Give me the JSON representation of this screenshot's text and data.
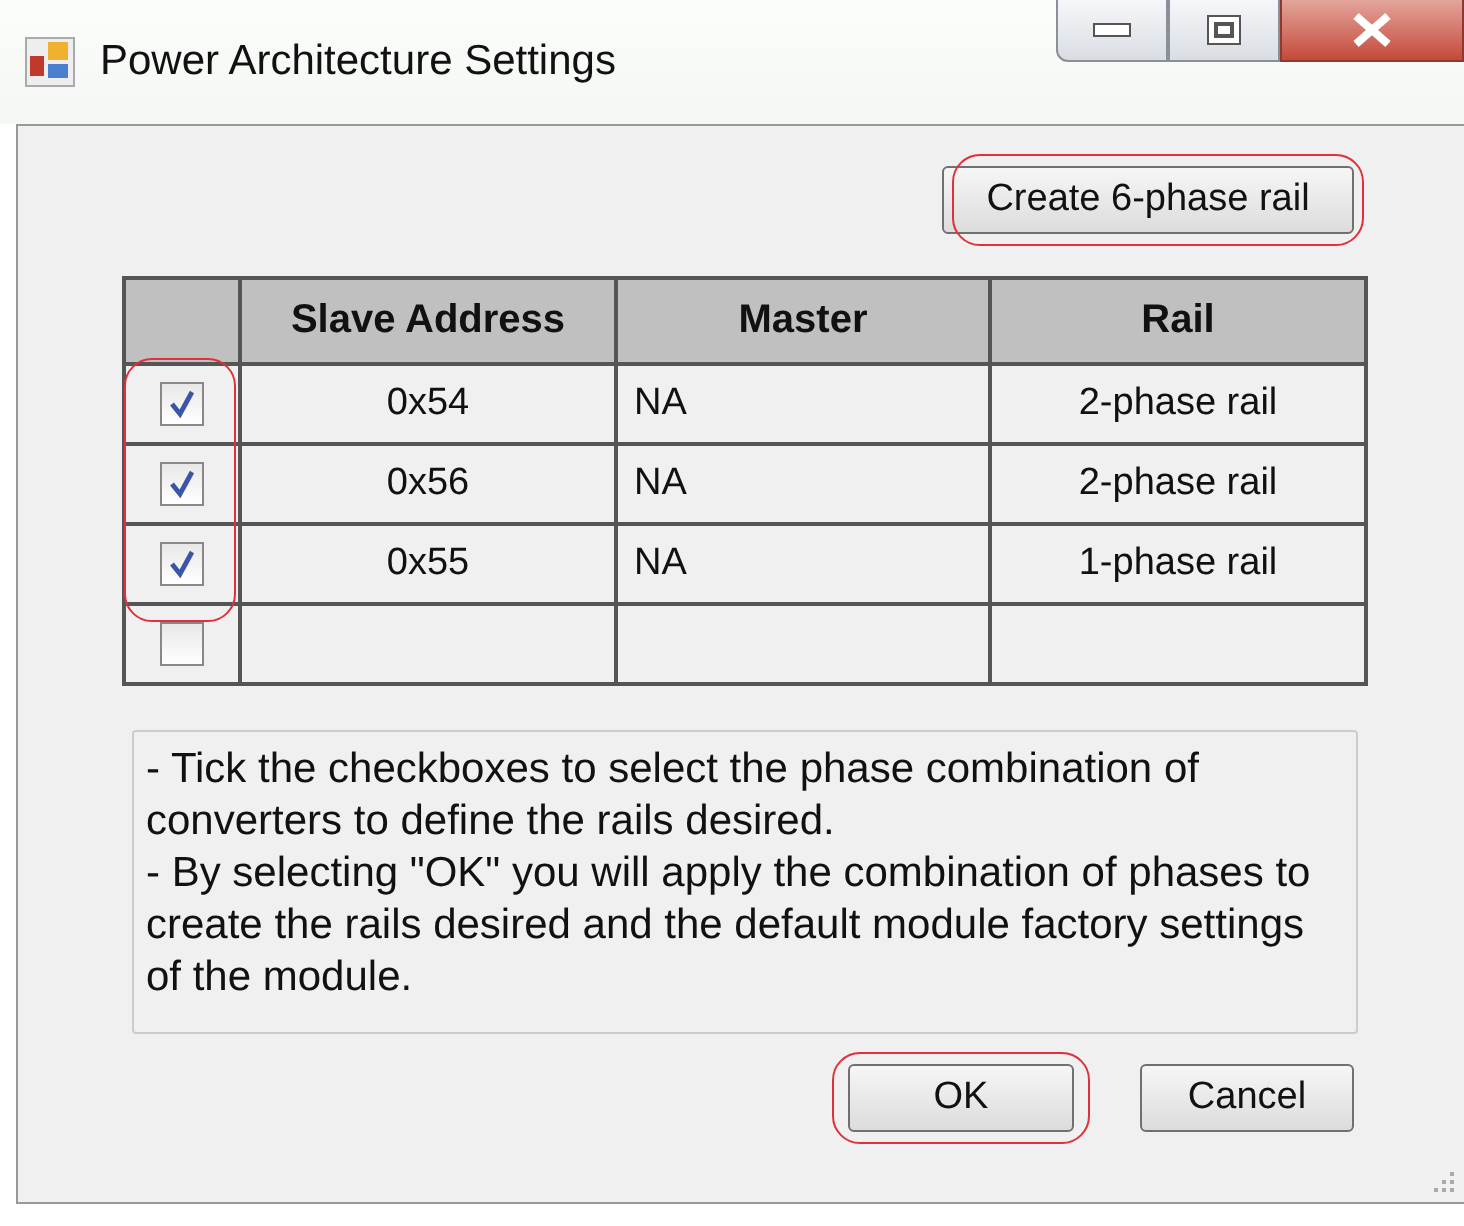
{
  "window": {
    "title": "Power Architecture Settings"
  },
  "create_button": {
    "label": "Create 6-phase rail",
    "highlighted": true
  },
  "table": {
    "columns": [
      "Slave Address",
      "Master",
      "Rail"
    ],
    "rows": [
      {
        "checked": true,
        "highlighted": true,
        "cells": [
          "0x54",
          "NA",
          "2-phase rail"
        ]
      },
      {
        "checked": true,
        "highlighted": true,
        "cells": [
          "0x56",
          "NA",
          "2-phase rail"
        ]
      },
      {
        "checked": true,
        "highlighted": true,
        "cells": [
          "0x55",
          "NA",
          "1-phase rail"
        ]
      },
      {
        "checked": false,
        "highlighted": false,
        "cells": [
          "",
          "",
          ""
        ]
      }
    ]
  },
  "note": "- Tick the checkboxes to select the phase combination of converters to define the rails desired.\n- By selecting \"OK\" you will apply the combination of phases to create the rails desired and the default module factory settings of the module.",
  "buttons": [
    {
      "label": "OK",
      "highlighted": true
    },
    {
      "label": "Cancel",
      "highlighted": false
    }
  ]
}
